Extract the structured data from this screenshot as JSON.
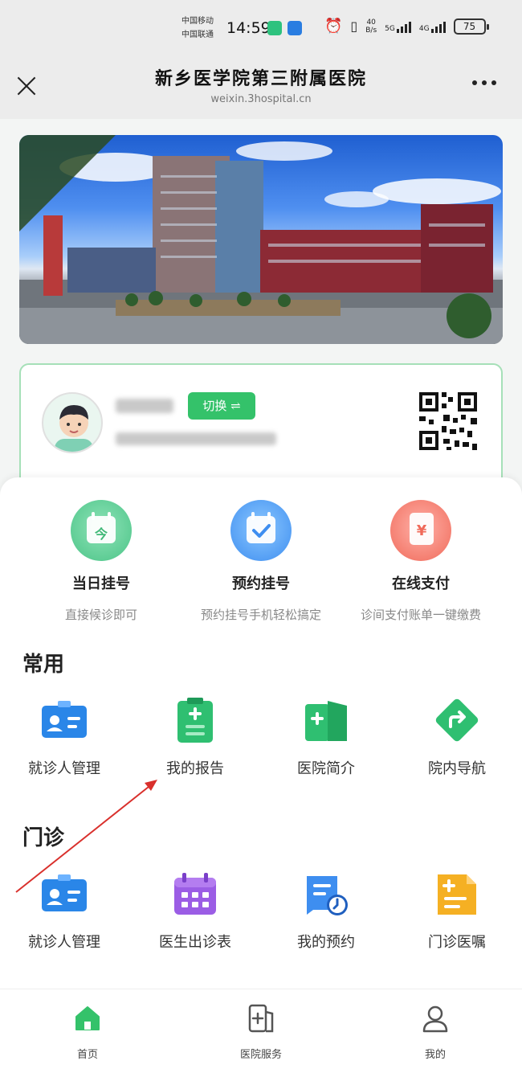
{
  "status_bar": {
    "carrier_1": "中国移动",
    "carrier_2": "中国联通",
    "time": "14:59",
    "net_speed_value": "40",
    "net_speed_unit": "B/s",
    "network_5g": "5G",
    "network_4g": "4G",
    "battery": "75"
  },
  "title_bar": {
    "title": "新乡医学院第三附属医院",
    "domain": "weixin.3hospital.cn"
  },
  "patient_card": {
    "switch_label": "切换 ⇌"
  },
  "quick_actions": [
    {
      "label": "当日挂号",
      "desc": "直接候诊即可",
      "icon": "calendar-today-icon"
    },
    {
      "label": "预约挂号",
      "desc": "预约挂号手机轻松搞定",
      "icon": "calendar-check-icon"
    },
    {
      "label": "在线支付",
      "desc": "诊间支付账单一键缴费",
      "icon": "payment-yen-icon"
    }
  ],
  "sections": {
    "common": {
      "title": "常用",
      "items": [
        {
          "label": "就诊人管理",
          "icon": "id-card-icon"
        },
        {
          "label": "我的报告",
          "icon": "clipboard-report-icon"
        },
        {
          "label": "医院简介",
          "icon": "hospital-intro-icon"
        },
        {
          "label": "院内导航",
          "icon": "navigation-arrow-icon"
        }
      ]
    },
    "outpatient": {
      "title": "门诊",
      "items": [
        {
          "label": "就诊人管理",
          "icon": "id-card-icon"
        },
        {
          "label": "医生出诊表",
          "icon": "schedule-calendar-icon"
        },
        {
          "label": "我的预约",
          "icon": "appointment-icon"
        },
        {
          "label": "门诊医嘱",
          "icon": "medical-order-icon"
        }
      ]
    }
  },
  "tab_bar": [
    {
      "label": "首页",
      "icon": "home-icon"
    },
    {
      "label": "医院服务",
      "icon": "hospital-service-icon"
    },
    {
      "label": "我的",
      "icon": "user-icon"
    }
  ],
  "colors": {
    "accent_green": "#34c26a",
    "card_border": "#a6e0b8",
    "annotation_red": "#d9302c"
  }
}
